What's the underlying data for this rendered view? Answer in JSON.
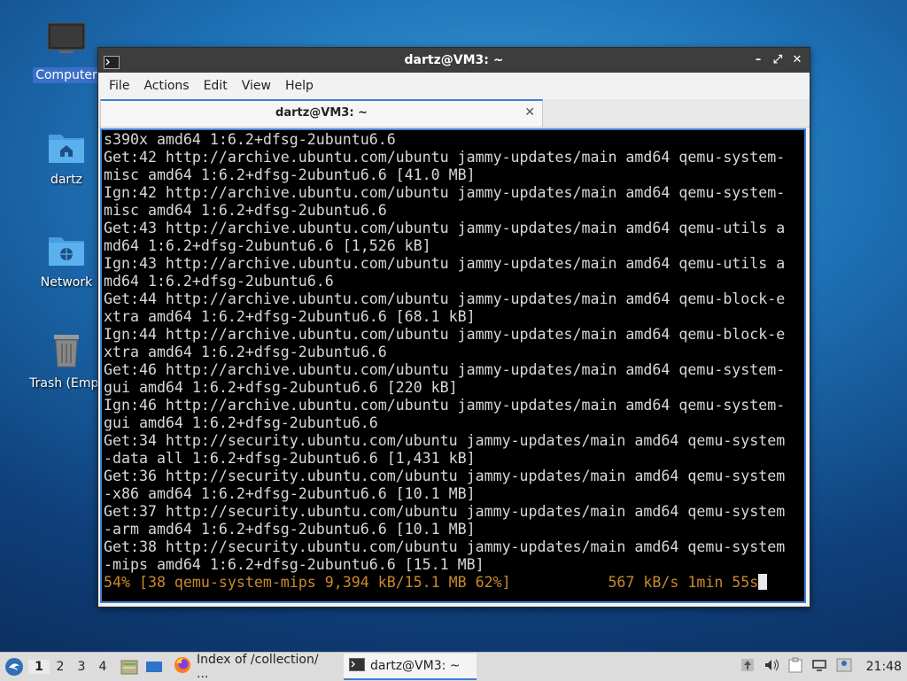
{
  "desktop": {
    "icons": [
      {
        "label": "Computer",
        "icon": "monitor-icon"
      },
      {
        "label": "dartz",
        "icon": "home-folder-icon"
      },
      {
        "label": "Network",
        "icon": "network-folder-icon"
      },
      {
        "label": "Trash (Empt",
        "icon": "trash-icon"
      }
    ]
  },
  "window": {
    "title": "dartz@VM3: ~",
    "menu": [
      "File",
      "Actions",
      "Edit",
      "View",
      "Help"
    ],
    "tab_title": "dartz@VM3: ~",
    "terminal_lines": [
      "s390x amd64 1:6.2+dfsg-2ubuntu6.6",
      "Get:42 http://archive.ubuntu.com/ubuntu jammy-updates/main amd64 qemu-system-",
      "misc amd64 1:6.2+dfsg-2ubuntu6.6 [41.0 MB]",
      "Ign:42 http://archive.ubuntu.com/ubuntu jammy-updates/main amd64 qemu-system-",
      "misc amd64 1:6.2+dfsg-2ubuntu6.6",
      "Get:43 http://archive.ubuntu.com/ubuntu jammy-updates/main amd64 qemu-utils a",
      "md64 1:6.2+dfsg-2ubuntu6.6 [1,526 kB]",
      "Ign:43 http://archive.ubuntu.com/ubuntu jammy-updates/main amd64 qemu-utils a",
      "md64 1:6.2+dfsg-2ubuntu6.6",
      "Get:44 http://archive.ubuntu.com/ubuntu jammy-updates/main amd64 qemu-block-e",
      "xtra amd64 1:6.2+dfsg-2ubuntu6.6 [68.1 kB]",
      "Ign:44 http://archive.ubuntu.com/ubuntu jammy-updates/main amd64 qemu-block-e",
      "xtra amd64 1:6.2+dfsg-2ubuntu6.6",
      "Get:46 http://archive.ubuntu.com/ubuntu jammy-updates/main amd64 qemu-system-",
      "gui amd64 1:6.2+dfsg-2ubuntu6.6 [220 kB]",
      "Ign:46 http://archive.ubuntu.com/ubuntu jammy-updates/main amd64 qemu-system-",
      "gui amd64 1:6.2+dfsg-2ubuntu6.6",
      "Get:34 http://security.ubuntu.com/ubuntu jammy-updates/main amd64 qemu-system",
      "-data all 1:6.2+dfsg-2ubuntu6.6 [1,431 kB]",
      "Get:36 http://security.ubuntu.com/ubuntu jammy-updates/main amd64 qemu-system",
      "-x86 amd64 1:6.2+dfsg-2ubuntu6.6 [10.1 MB]",
      "Get:37 http://security.ubuntu.com/ubuntu jammy-updates/main amd64 qemu-system",
      "-arm amd64 1:6.2+dfsg-2ubuntu6.6 [10.1 MB]",
      "Get:38 http://security.ubuntu.com/ubuntu jammy-updates/main amd64 qemu-system",
      "-mips amd64 1:6.2+dfsg-2ubuntu6.6 [15.1 MB]"
    ],
    "progress_line": "54% [38 qemu-system-mips 9,394 kB/15.1 MB 62%]           567 kB/s 1min 55s",
    "progress_color": "#c98a2a"
  },
  "taskbar": {
    "workspaces": [
      "1",
      "2",
      "3",
      "4"
    ],
    "active_workspace": "1",
    "tasks": [
      {
        "label": "Index of /collection/ ...",
        "icon": "firefox-icon"
      },
      {
        "label": "dartz@VM3: ~",
        "icon": "terminal-icon"
      }
    ],
    "clock": "21:48"
  },
  "colors": {
    "accent": "#3d7fd6",
    "titlebar": "#3d3d3d",
    "terminal_bg": "#000000"
  }
}
